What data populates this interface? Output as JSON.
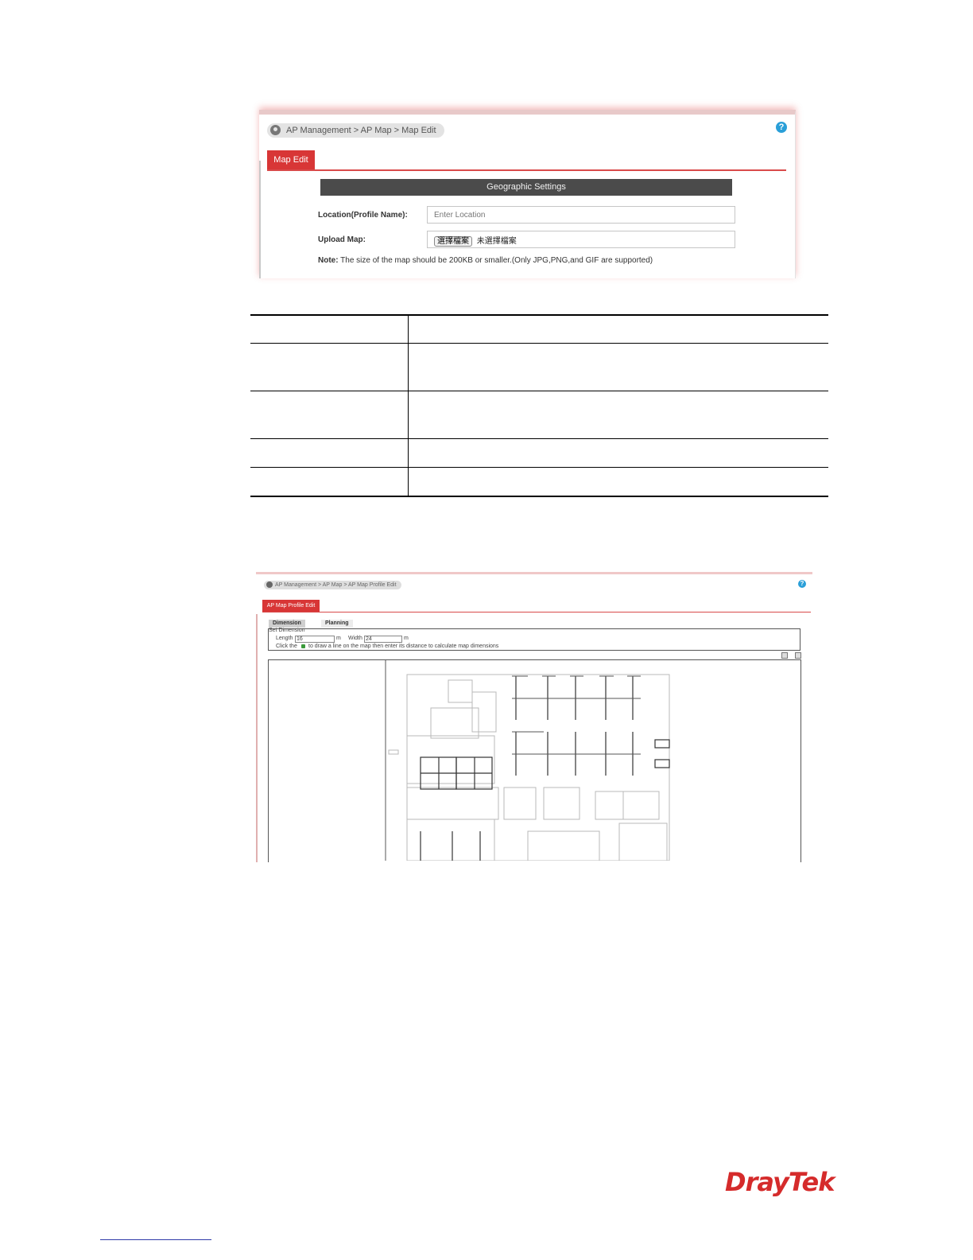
{
  "shot1": {
    "breadcrumb": "AP Management  > AP Map  > Map Edit",
    "help_glyph": "?",
    "tab": "Map Edit",
    "section_title": "Geographic Settings",
    "location_label": "Location(Profile Name):",
    "location_placeholder": "Enter Location",
    "upload_label": "Upload Map:",
    "file_button": "選擇檔案",
    "file_status": "未選擇檔案",
    "note_bold": "Note:",
    "note_text": " The size of the map should be 200KB or smaller.(Only JPG,PNG,and GIF are supported)"
  },
  "shot2": {
    "breadcrumb": "AP Management  >  AP Map  >  AP Map Profile Edit",
    "help_glyph": "?",
    "tab": "AP Map Profile Edit",
    "subtab_dimension": "Dimension",
    "subtab_planning": "Planning",
    "set_dimension_label": "Set Dimension",
    "length_label": "Length",
    "length_value": "16",
    "unit_m": "m",
    "width_label": "Width",
    "width_value": "24",
    "click_the": "Click the",
    "instruction": "to draw a line on the map then enter its distance to calculate map dimensions"
  },
  "logo": "DrayTek",
  "colors": {
    "accent_red": "#d83636",
    "header_dark": "#4b4b4b",
    "help_blue": "#2a9fd8",
    "footer_link": "#2e3aa8"
  },
  "icons": {
    "breadcrumb": "location-pin-icon",
    "help": "help-icon",
    "draw_line": "pencil-icon"
  }
}
